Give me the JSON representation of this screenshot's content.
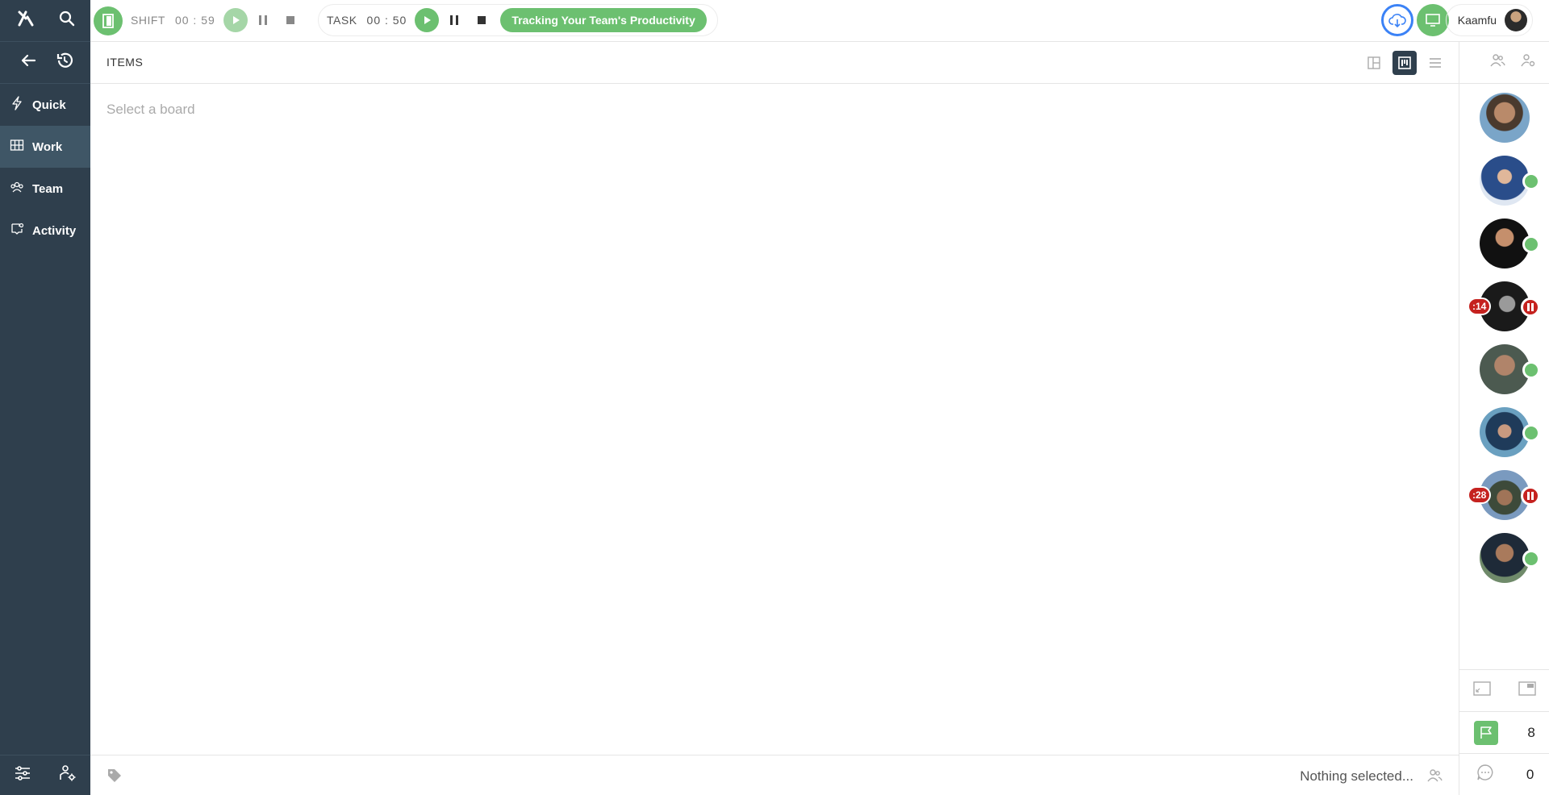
{
  "topbar": {
    "shift_label": "SHIFT",
    "shift_time": "00 : 59",
    "task_label": "TASK",
    "task_time": "00 : 50",
    "task_name": "Tracking Your Team's Productivity",
    "user_name": "Kaamfu"
  },
  "sidebar": {
    "items": [
      {
        "label": "Quick",
        "icon": "lightning-icon"
      },
      {
        "label": "Work",
        "icon": "board-icon"
      },
      {
        "label": "Team",
        "icon": "team-icon"
      },
      {
        "label": "Activity",
        "icon": "activity-icon"
      }
    ]
  },
  "main": {
    "header_title": "ITEMS",
    "placeholder": "Select a board"
  },
  "bottombar": {
    "status": "Nothing selected..."
  },
  "rightpanel": {
    "members": [
      {
        "status": "none"
      },
      {
        "status": "online"
      },
      {
        "status": "online"
      },
      {
        "status": "paused",
        "badge": ":14"
      },
      {
        "status": "online"
      },
      {
        "status": "online"
      },
      {
        "status": "paused",
        "badge": ":28"
      },
      {
        "status": "online"
      }
    ],
    "flag_count": "8",
    "chat_count": "0"
  },
  "colors": {
    "sidebar": "#2f3f4d",
    "accent_green": "#6cc070",
    "badge_red": "#c5221f",
    "cloud_blue": "#3b82f6"
  }
}
